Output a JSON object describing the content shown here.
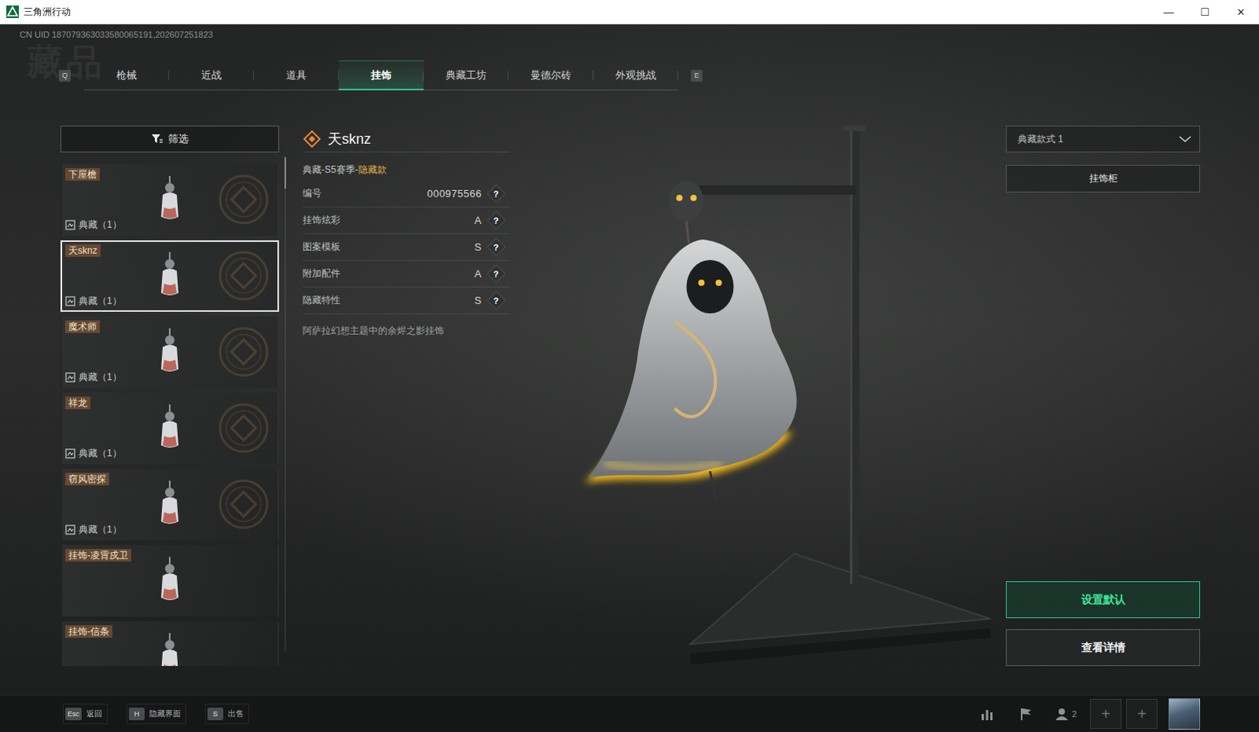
{
  "window": {
    "title": "三角洲行动",
    "controls": [
      "—",
      "☐",
      "✕"
    ]
  },
  "uid": "CN UID 187079363033580065191,202607251823",
  "watermark": "藏品",
  "tab_keys": {
    "prev": "Q",
    "next": "E"
  },
  "tabs": [
    {
      "label": "枪械",
      "selected": false
    },
    {
      "label": "近战",
      "selected": false
    },
    {
      "label": "道具",
      "selected": false
    },
    {
      "label": "挂饰",
      "selected": true
    },
    {
      "label": "典藏工坊",
      "selected": false
    },
    {
      "label": "曼德尔砖",
      "selected": false
    },
    {
      "label": "外观挑战",
      "selected": false
    }
  ],
  "filter": {
    "label": "筛选"
  },
  "items": [
    {
      "name": "下屋檐",
      "count": "典藏（1）",
      "selected": false
    },
    {
      "name": "天sknz",
      "count": "典藏（1）",
      "selected": true
    },
    {
      "name": "魔术师",
      "count": "典藏（1）",
      "selected": false
    },
    {
      "name": "祥龙",
      "count": "典藏（1）",
      "selected": false
    },
    {
      "name": "窃风密探",
      "count": "典藏（1）",
      "selected": false
    },
    {
      "name": "挂饰-凌霄戍卫",
      "selected": false
    },
    {
      "name": "挂饰-信条",
      "selected": false
    }
  ],
  "detail": {
    "name": "天sknz",
    "series": "典藏-S5赛季-",
    "rarity": "隐藏款",
    "attributes": [
      {
        "label": "编号",
        "value": "000975566",
        "help": "?"
      },
      {
        "label": "挂饰炫彩",
        "value": "A",
        "help": "?"
      },
      {
        "label": "图案模板",
        "value": "S",
        "help": "?"
      },
      {
        "label": "附加配件",
        "value": "A",
        "help": "?"
      },
      {
        "label": "隐藏特性",
        "value": "S",
        "help": "?"
      }
    ],
    "description": "阿萨拉幻想主题中的余烬之影挂饰"
  },
  "style_select": {
    "value": "典藏款式 1"
  },
  "cabinet_button": "挂饰柜",
  "actions": [
    {
      "label": "设置默认",
      "primary": true
    },
    {
      "label": "查看详情",
      "primary": false
    }
  ],
  "hotkeys": [
    {
      "key": "Esc",
      "label": "返回"
    },
    {
      "key": "H",
      "label": "隐藏界面"
    },
    {
      "key": "S",
      "label": "出售"
    }
  ],
  "social": {
    "friends": "2",
    "slots": [
      "+",
      "+"
    ]
  }
}
